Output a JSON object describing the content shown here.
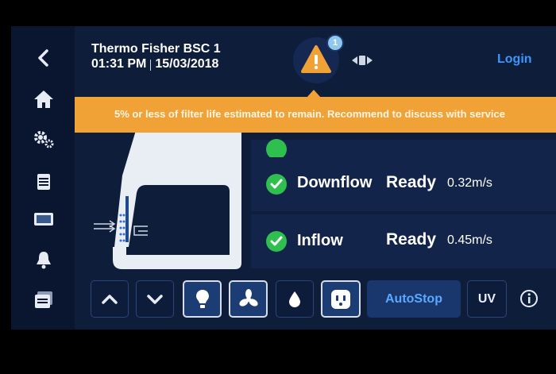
{
  "header": {
    "title": "Thermo Fisher BSC 1",
    "time": "01:31 PM",
    "date": "15/03/2018",
    "login_label": "Login"
  },
  "alert": {
    "count": "1",
    "message": "5% or less of filter life estimated to remain. Recommend to discuss with service"
  },
  "status": [
    {
      "name": "Downflow",
      "state": "Ready",
      "value": "0.32m/s"
    },
    {
      "name": "Inflow",
      "state": "Ready",
      "value": "0.45m/s"
    }
  ],
  "controls": {
    "autostop_label": "AutoStop",
    "uv_label": "UV"
  },
  "sidebar": {
    "items": [
      "back-icon",
      "home-icon",
      "settings-icon",
      "calendar-icon",
      "display-icon",
      "bell-icon",
      "files-icon"
    ]
  },
  "colors": {
    "background": "#0e1d3a",
    "sidebar": "#0a1630",
    "warning": "#f0a236",
    "accent": "#3d95ff",
    "ok": "#2fbf4e"
  }
}
